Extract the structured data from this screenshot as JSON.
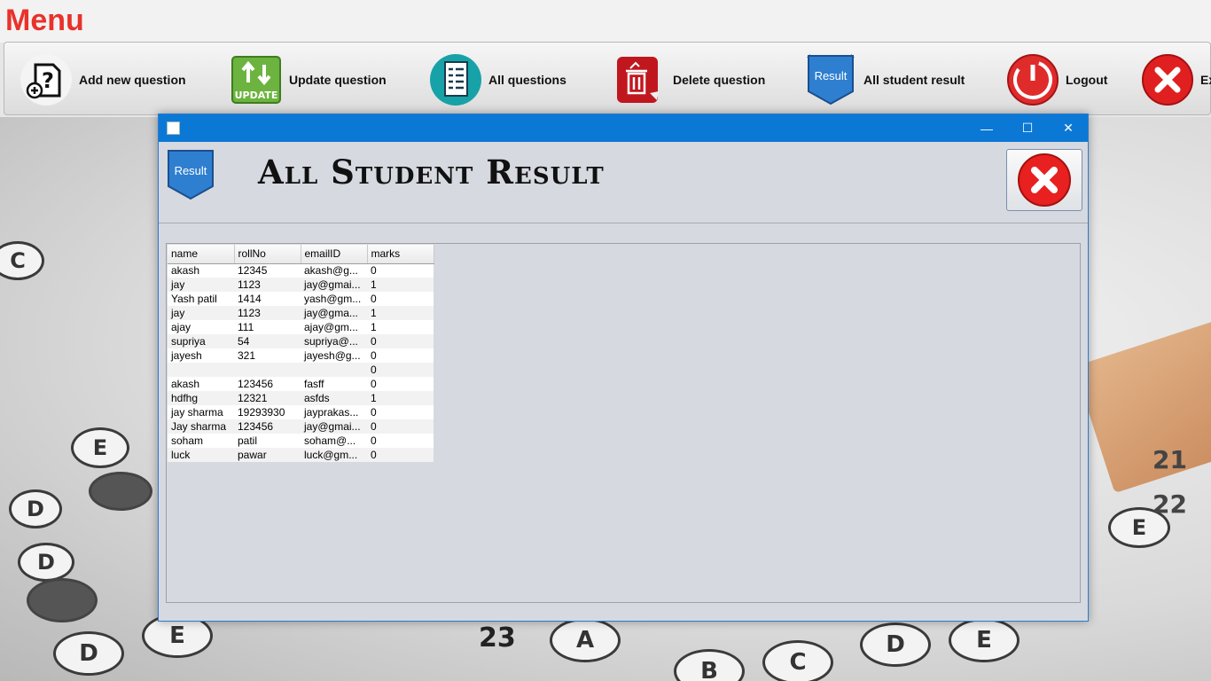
{
  "app": {
    "menu_title": "Menu"
  },
  "toolbar": [
    {
      "label": "Add new question",
      "icon": "add-question-icon"
    },
    {
      "label": "Update question",
      "icon": "update-icon"
    },
    {
      "label": "All questions",
      "icon": "list-icon"
    },
    {
      "label": "Delete question",
      "icon": "trash-icon"
    },
    {
      "label": "All student result",
      "icon": "result-ribbon-icon"
    },
    {
      "label": "Logout",
      "icon": "power-icon"
    },
    {
      "label": "Ex",
      "icon": "close-icon"
    }
  ],
  "dialog": {
    "heading": "All Student Result",
    "ribbon_text": "Result",
    "window_controls": {
      "minimize": "—",
      "maximize": "☐",
      "close": "✕"
    }
  },
  "table": {
    "columns": [
      "name",
      "rollNo",
      "emailID",
      "marks"
    ],
    "rows": [
      [
        "akash",
        "12345",
        "akash@g...",
        "0"
      ],
      [
        "jay",
        "1123",
        "jay@gmai...",
        "1"
      ],
      [
        "Yash patil",
        "1414",
        "yash@gm...",
        "0"
      ],
      [
        "jay",
        "1123",
        " jay@gma...",
        "1"
      ],
      [
        "ajay",
        "111",
        " ajay@gm...",
        "1"
      ],
      [
        "supriya",
        "54",
        "supriya@...",
        "0"
      ],
      [
        "jayesh",
        "321",
        "jayesh@g...",
        "0"
      ],
      [
        "",
        "",
        "",
        "0"
      ],
      [
        "akash",
        "123456",
        "fasff",
        "0"
      ],
      [
        "hdfhg",
        "12321",
        "asfds",
        "1"
      ],
      [
        "jay sharma",
        "19293930",
        "jayprakas...",
        "0"
      ],
      [
        "Jay sharma",
        "123456",
        "jay@gmai...",
        "0"
      ],
      [
        "soham",
        "patil",
        "soham@...",
        "0"
      ],
      [
        "luck",
        "pawar",
        "luck@gm...",
        "0"
      ]
    ]
  },
  "background": {
    "bubble_letters": [
      "C",
      "D",
      "E",
      "D",
      "E",
      "D",
      "E",
      "D",
      "E",
      "D",
      "A",
      "B",
      "C",
      "D",
      "E"
    ],
    "numbers": [
      "23",
      "21",
      "22"
    ]
  },
  "colors": {
    "menu_title": "#e8322b",
    "titlebar": "#0b78d6",
    "dialog_bg": "#d6d9e0"
  }
}
